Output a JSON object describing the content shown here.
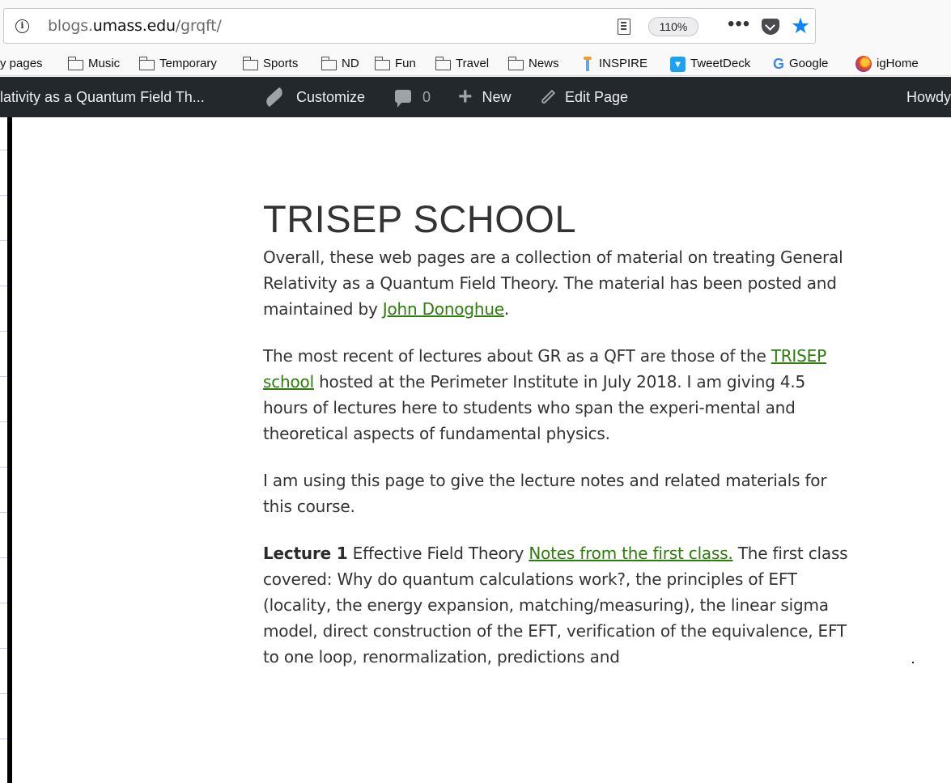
{
  "browser": {
    "url_prefix": "blogs.",
    "url_domain": "umass.edu",
    "url_path": "/grqft/",
    "zoom": "110%",
    "more_glyph": "•••"
  },
  "bookmarks": [
    {
      "label": "y pages",
      "icon": "none"
    },
    {
      "label": "Music",
      "icon": "folder-icon"
    },
    {
      "label": "Temporary",
      "icon": "folder-icon"
    },
    {
      "label": "Sports",
      "icon": "folder-icon"
    },
    {
      "label": "ND",
      "icon": "folder-icon"
    },
    {
      "label": "Fun",
      "icon": "folder-icon"
    },
    {
      "label": "Travel",
      "icon": "folder-icon"
    },
    {
      "label": "News",
      "icon": "folder-icon"
    },
    {
      "label": "INSPIRE",
      "icon": "inspire-icon"
    },
    {
      "label": "TweetDeck",
      "icon": "tweetdeck-icon"
    },
    {
      "label": "Google",
      "icon": "google-icon"
    },
    {
      "label": "igHome",
      "icon": "ighome-icon"
    }
  ],
  "admin_bar": {
    "site_title": "lativity as a Quantum Field Th...",
    "customize": "Customize",
    "comments": "0",
    "new": "New",
    "edit": "Edit Page",
    "howdy": "Howdy"
  },
  "page": {
    "title": "TRISEP SCHOOL",
    "p1_text": "Overall, these web pages are a collection of material on treating General Relativity as a Quantum Field Theory. The material has been posted and maintained by ",
    "p1_link": "John Donoghue",
    "p1_end": ".",
    "p2_link": "TRISEP school",
    "p2_text": " hosted at the Perimeter Institute in July 2018. I am giving 4.5 hours of lectures here to students who span the experi-mental and theoretical aspects of fundamental physics.",
    "p2_start": "The most recent of lectures about GR as a QFT are those of the ",
    "p3_text": "I am using this page to give the lecture notes and related materials for this course.",
    "p4_bold": "Lecture 1",
    "p4_text1": " Effective Field Theory ",
    "p4_link": "Notes from the first class.",
    "p4_text2": " The first class covered: Why do quantum calculations work?, the principles of EFT (locality, the energy expansion, matching/measuring), the linear sigma model, direct construction of the EFT, verification of the equivalence, EFT to one loop, renormalization, predictions and"
  },
  "colors": {
    "link": "#2d7d0c",
    "admin_bar": "#23282d",
    "star": "#0a84ff"
  }
}
